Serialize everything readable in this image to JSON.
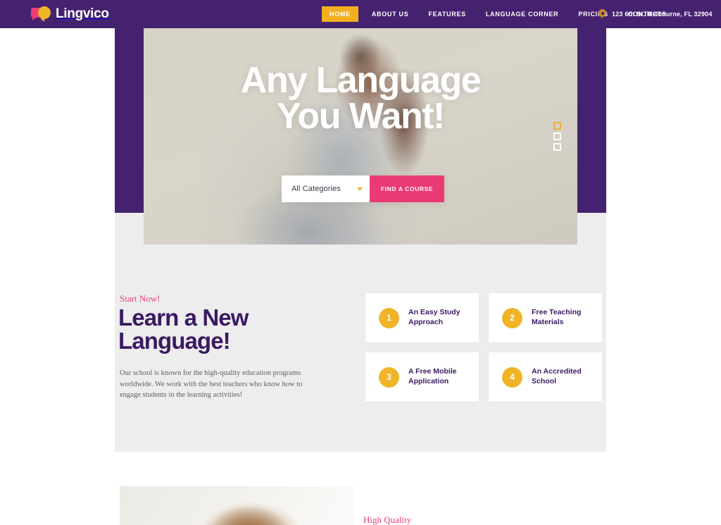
{
  "site": {
    "brand": "Lingvico",
    "logo_icons": [
      "speech-bubble-pink",
      "speech-bubble-yellow"
    ]
  },
  "topbar": {
    "nav": [
      {
        "label": "HOME",
        "active": true
      },
      {
        "label": "ABOUT US",
        "active": false
      },
      {
        "label": "FEATURES",
        "active": false
      },
      {
        "label": "LANGUAGE CORNER",
        "active": false
      },
      {
        "label": "PRICING",
        "active": false
      },
      {
        "label": "CONTACTS",
        "active": false
      }
    ],
    "address": "123 6th St. Melbourne, FL 32904",
    "address_icon": "location-pin-icon",
    "background_color": "#452270",
    "active_color": "#f2b01e"
  },
  "hero": {
    "title_line1": "Any Language",
    "title_line2": "You Want!",
    "search": {
      "category_value": "All Categories",
      "category_icon": "chevron-down-icon",
      "submit_label": "FIND A COURSE",
      "submit_color": "#ea3a74"
    },
    "slider": {
      "dots": [
        {
          "active": true
        },
        {
          "active": false
        },
        {
          "active": false
        }
      ],
      "active_color": "#e8b33c"
    }
  },
  "learn_section": {
    "eyebrow": "Start Now!",
    "eyebrow_color": "#ee3d6f",
    "title_line1": "Learn a New",
    "title_line2": "Language!",
    "title_color": "#3b1a63",
    "body": "Our school is known for the high-quality education programs worldwide. We work with the best teachers who know how to engage students in the learning activities!",
    "background_color": "#ededed",
    "cards": [
      {
        "number": "1",
        "line1": "An Easy Study",
        "line2": "Approach"
      },
      {
        "number": "2",
        "line1": "Free Teaching",
        "line2": "Materials"
      },
      {
        "number": "3",
        "line1": "A Free Mobile",
        "line2": "Application"
      },
      {
        "number": "4",
        "line1": "An Accredited",
        "line2": "School"
      }
    ],
    "card_badge_color": "#f0b429"
  },
  "bottom_section": {
    "eyebrow": "High Quality",
    "eyebrow_color": "#ee3d6f"
  }
}
